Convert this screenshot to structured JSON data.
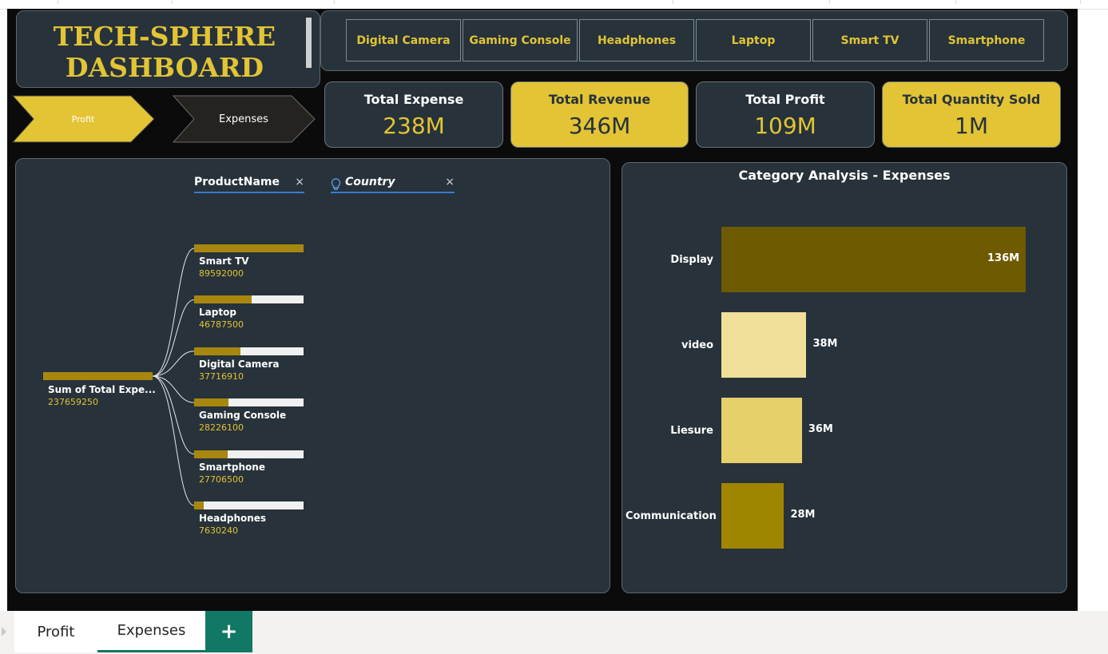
{
  "title": {
    "line1": "TECH-SPHERE",
    "line2": "DASHBOARD"
  },
  "slicers": [
    "Digital Camera",
    "Gaming Console",
    "Headphones",
    "Laptop",
    "Smart TV",
    "Smartphone"
  ],
  "nav": {
    "profit": "Profit",
    "expenses": "Expenses"
  },
  "kpis": [
    {
      "label": "Total Expense",
      "value": "238M"
    },
    {
      "label": "Total Revenue",
      "value": "346M"
    },
    {
      "label": "Total Profit",
      "value": "109M"
    },
    {
      "label": "Total Quantity Sold",
      "value": "1M"
    }
  ],
  "decomposition": {
    "fields": {
      "product": "ProductName",
      "country": "Country",
      "close": "×",
      "bulb_icon": "lightbulb-icon"
    },
    "root": {
      "label": "Sum of Total Expe...",
      "value": "237659250",
      "raw": 237659250
    },
    "items": [
      {
        "label": "Smart TV",
        "value": "89592000",
        "raw": 89592000
      },
      {
        "label": "Laptop",
        "value": "46787500",
        "raw": 46787500
      },
      {
        "label": "Digital Camera",
        "value": "37716910",
        "raw": 37716910
      },
      {
        "label": "Gaming Console",
        "value": "28226100",
        "raw": 28226100
      },
      {
        "label": "Smartphone",
        "value": "27706500",
        "raw": 27706500
      },
      {
        "label": "Headphones",
        "value": "7630240",
        "raw": 7630240
      }
    ]
  },
  "chart_data": {
    "type": "bar",
    "orientation": "horizontal",
    "title": "Category Analysis - Expenses",
    "categories": [
      "Display",
      "video",
      "Liesure",
      "Communication"
    ],
    "values": [
      136,
      38,
      36,
      28
    ],
    "data_labels": [
      "136M",
      "38M",
      "36M",
      "28M"
    ],
    "colors": [
      "#6e5a00",
      "#f0df98",
      "#e6d06a",
      "#a08500"
    ],
    "xlim": [
      0,
      136
    ]
  },
  "tabs": {
    "profit": "Profit",
    "expenses": "Expenses",
    "add": "+"
  },
  "colors": {
    "gold": "#e2c435",
    "panel": "#27323a",
    "canvas": "#0b0b0b",
    "accent_green": "#117865"
  }
}
